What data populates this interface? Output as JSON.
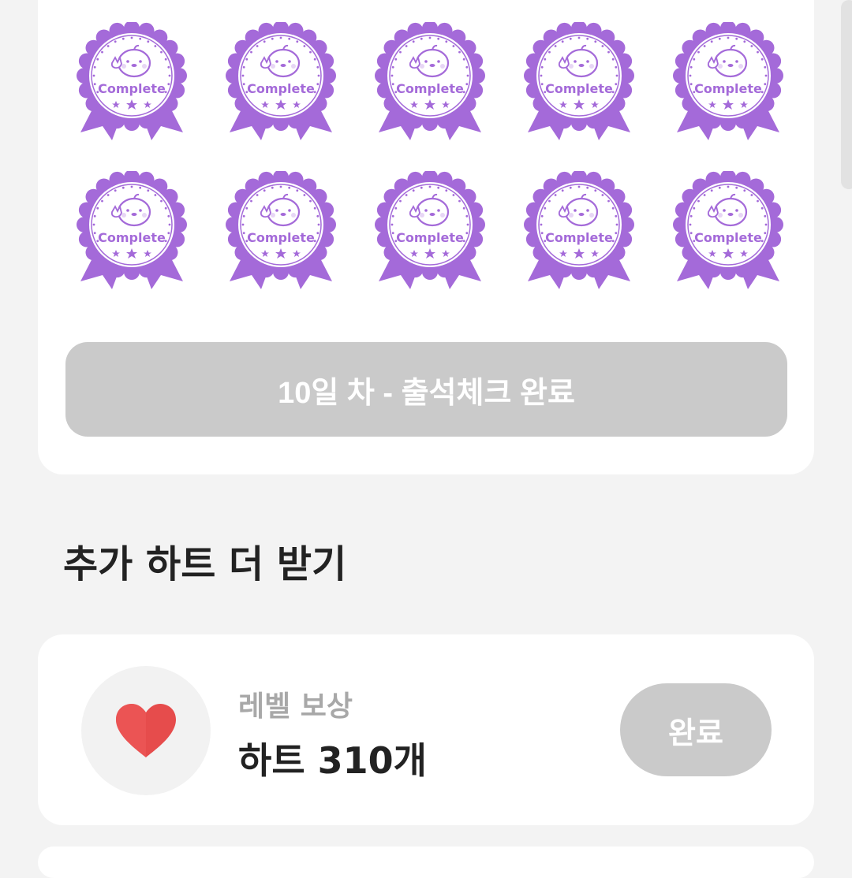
{
  "attendance": {
    "badges": [
      {
        "label": "Complete"
      },
      {
        "label": "Complete"
      },
      {
        "label": "Complete"
      },
      {
        "label": "Complete"
      },
      {
        "label": "Complete"
      },
      {
        "label": "Complete"
      },
      {
        "label": "Complete"
      },
      {
        "label": "Complete"
      },
      {
        "label": "Complete"
      },
      {
        "label": "Complete"
      }
    ],
    "badge_color": "#a46ad9",
    "status_button_label": "10일 차 - 출석체크 완료"
  },
  "extra_hearts": {
    "title": "추가 하트 더 받기",
    "reward": {
      "icon": "heart-icon",
      "category": "레벨 보상",
      "amount_label": "하트 310개",
      "button_label": "완료"
    }
  },
  "colors": {
    "background": "#f3f3f3",
    "card": "#ffffff",
    "disabled_button": "#cacaca",
    "heart": "#e64c4c"
  }
}
